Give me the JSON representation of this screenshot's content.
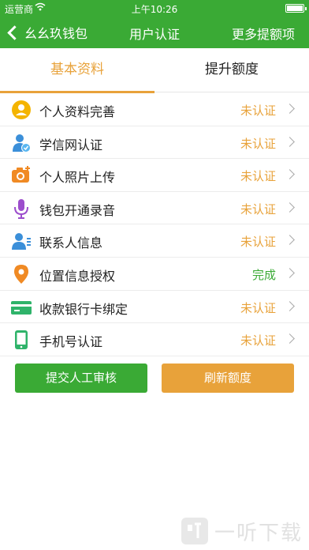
{
  "status_bar": {
    "carrier": "运营商",
    "time": "上午10:26"
  },
  "nav": {
    "back_label": "幺幺玖钱包",
    "title": "用户认证",
    "right_label": "更多提额项"
  },
  "tabs": [
    {
      "label": "基本资料"
    },
    {
      "label": "提升额度"
    }
  ],
  "rows": [
    {
      "title": "个人资料完善",
      "status": "未认证",
      "icon": "user-profile-icon",
      "color": "#f4b400"
    },
    {
      "title": "学信网认证",
      "status": "未认证",
      "icon": "student-id-icon",
      "color": "#3b8fd9"
    },
    {
      "title": "个人照片上传",
      "status": "未认证",
      "icon": "camera-icon",
      "color": "#f08a24"
    },
    {
      "title": "钱包开通录音",
      "status": "未认证",
      "icon": "microphone-icon",
      "color": "#9c4dcc"
    },
    {
      "title": "联系人信息",
      "status": "未认证",
      "icon": "contacts-icon",
      "color": "#3b8fd9"
    },
    {
      "title": "位置信息授权",
      "status": "完成",
      "icon": "location-pin-icon",
      "color": "#f08a24"
    },
    {
      "title": "收款银行卡绑定",
      "status": "未认证",
      "icon": "bank-card-icon",
      "color": "#2fb36a"
    },
    {
      "title": "手机号认证",
      "status": "未认证",
      "icon": "phone-icon",
      "color": "#2fb36a"
    }
  ],
  "actions": {
    "submit_label": "提交人工审核",
    "refresh_label": "刷新额度"
  },
  "watermark": {
    "text": "一听下载"
  },
  "colors": {
    "primary": "#3aaa35",
    "accent": "#e8a23a"
  }
}
